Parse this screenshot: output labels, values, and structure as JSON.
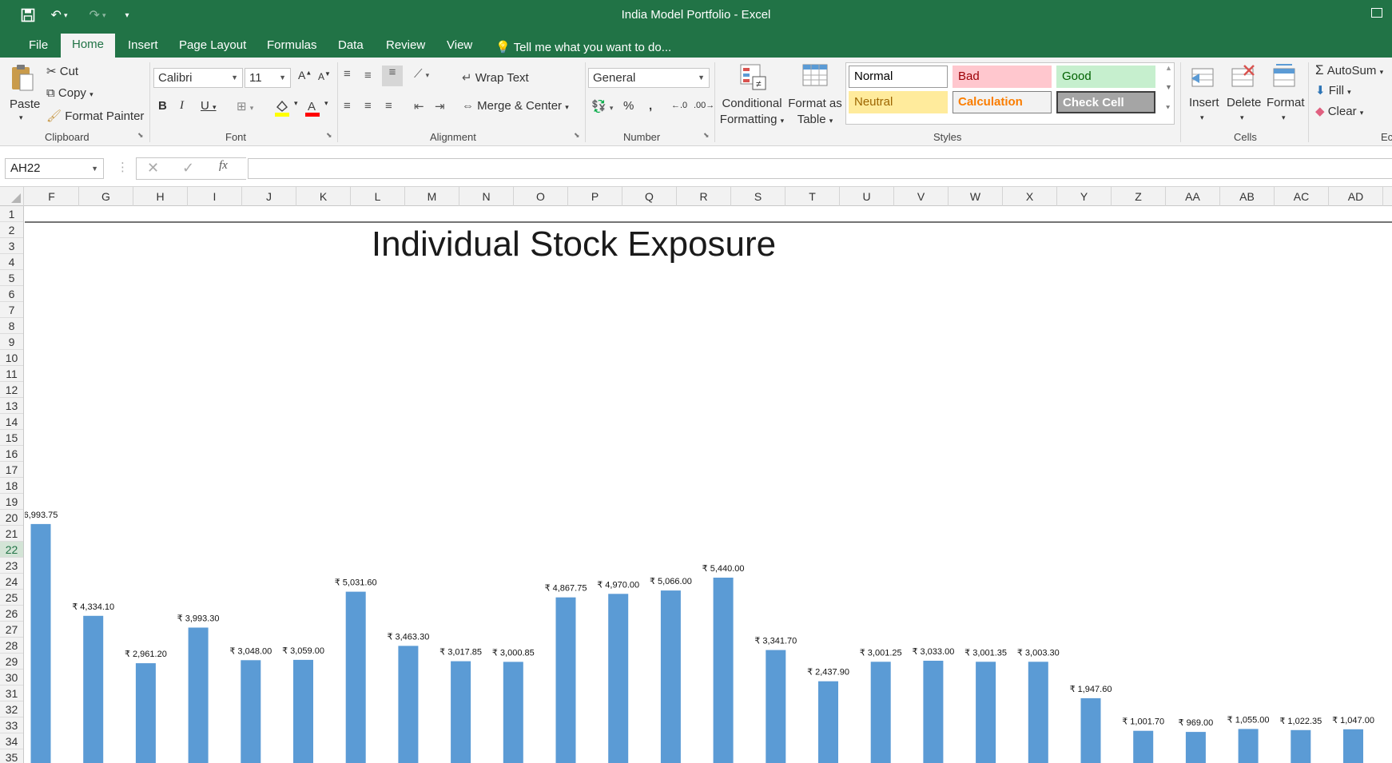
{
  "window": {
    "title": "India Model Portfolio - Excel"
  },
  "tabs": [
    "File",
    "Home",
    "Insert",
    "Page Layout",
    "Formulas",
    "Data",
    "Review",
    "View"
  ],
  "active_tab": "Home",
  "tell_me": "Tell me what you want to do...",
  "clipboard": {
    "paste": "Paste",
    "cut": "Cut",
    "copy": "Copy",
    "format_painter": "Format Painter",
    "label": "Clipboard"
  },
  "font": {
    "name": "Calibri",
    "size": "11",
    "label": "Font"
  },
  "alignment": {
    "wrap_text": "Wrap Text",
    "merge_center": "Merge & Center",
    "label": "Alignment"
  },
  "number": {
    "format": "General",
    "label": "Number"
  },
  "styles": {
    "conditional_formatting": [
      "Conditional",
      "Formatting"
    ],
    "format_as_table": [
      "Format as",
      "Table"
    ],
    "cells": [
      {
        "label": "Normal",
        "bg": "#ffffff",
        "fg": "#000000",
        "border": "#9a9a9a"
      },
      {
        "label": "Bad",
        "bg": "#ffc7ce",
        "fg": "#9c0006",
        "border": "#ffc7ce"
      },
      {
        "label": "Good",
        "bg": "#c6efce",
        "fg": "#006100",
        "border": "#c6efce"
      },
      {
        "label": "Neutral",
        "bg": "#ffeb9c",
        "fg": "#9c6500",
        "border": "#ffeb9c"
      },
      {
        "label": "Calculation",
        "bg": "#f2f2f2",
        "fg": "#fa7d00",
        "border": "#7f7f7f"
      },
      {
        "label": "Check Cell",
        "bg": "#a5a5a5",
        "fg": "#ffffff",
        "border": "#3f3f3f"
      }
    ],
    "label": "Styles"
  },
  "cells": {
    "insert": "Insert",
    "delete": "Delete",
    "format": "Format",
    "label": "Cells"
  },
  "editing": {
    "autosum": "AutoSum",
    "fill": "Fill",
    "clear": "Clear",
    "label": "Ec"
  },
  "name_box": "AH22",
  "columns": [
    "F",
    "G",
    "H",
    "I",
    "J",
    "K",
    "L",
    "M",
    "N",
    "O",
    "P",
    "Q",
    "R",
    "S",
    "T",
    "U",
    "V",
    "W",
    "X",
    "Y",
    "Z",
    "AA",
    "AB",
    "AC",
    "AD"
  ],
  "rows": [
    "1",
    "2",
    "3",
    "4",
    "5",
    "6",
    "7",
    "8",
    "9",
    "10",
    "11",
    "12",
    "13",
    "14",
    "15",
    "16",
    "17",
    "18",
    "19",
    "20",
    "21",
    "22",
    "23",
    "24",
    "25",
    "26",
    "27",
    "28",
    "29",
    "30",
    "31",
    "32",
    "33",
    "34",
    "35"
  ],
  "active_row": "22",
  "colors": {
    "excel_green": "#217346",
    "bar": "#5b9bd5"
  },
  "chart_data": {
    "type": "bar",
    "title": "Individual Stock Exposure",
    "values": [
      6993.75,
      4334.1,
      2961.2,
      3993.3,
      3048.0,
      3059.0,
      5031.6,
      3463.3,
      3017.85,
      3000.85,
      4867.75,
      4970.0,
      5066.0,
      5440.0,
      3341.7,
      2437.9,
      3001.25,
      3033.0,
      3001.35,
      3003.3,
      1947.6,
      1001.7,
      969.0,
      1055.0,
      1022.35,
      1047.0
    ],
    "data_labels": [
      "6,993.75",
      "₹ 4,334.10",
      "₹ 2,961.20",
      "₹ 3,993.30",
      "₹ 3,048.00",
      "₹ 3,059.00",
      "₹ 5,031.60",
      "₹ 3,463.30",
      "₹ 3,017.85",
      "₹ 3,000.85",
      "₹ 4,867.75",
      "₹ 4,970.00",
      "₹ 5,066.00",
      "₹ 5,440.00",
      "₹ 3,341.70",
      "₹ 2,437.90",
      "₹ 3,001.25",
      "₹ 3,033.00",
      "₹ 3,001.35",
      "₹ 3,003.30",
      "₹ 1,947.60",
      "₹ 1,001.70",
      "₹ 969.00",
      "₹ 1,055.00",
      "₹ 1,022.35",
      "₹ 1,047.00"
    ],
    "bar_color": "#5b9bd5"
  }
}
